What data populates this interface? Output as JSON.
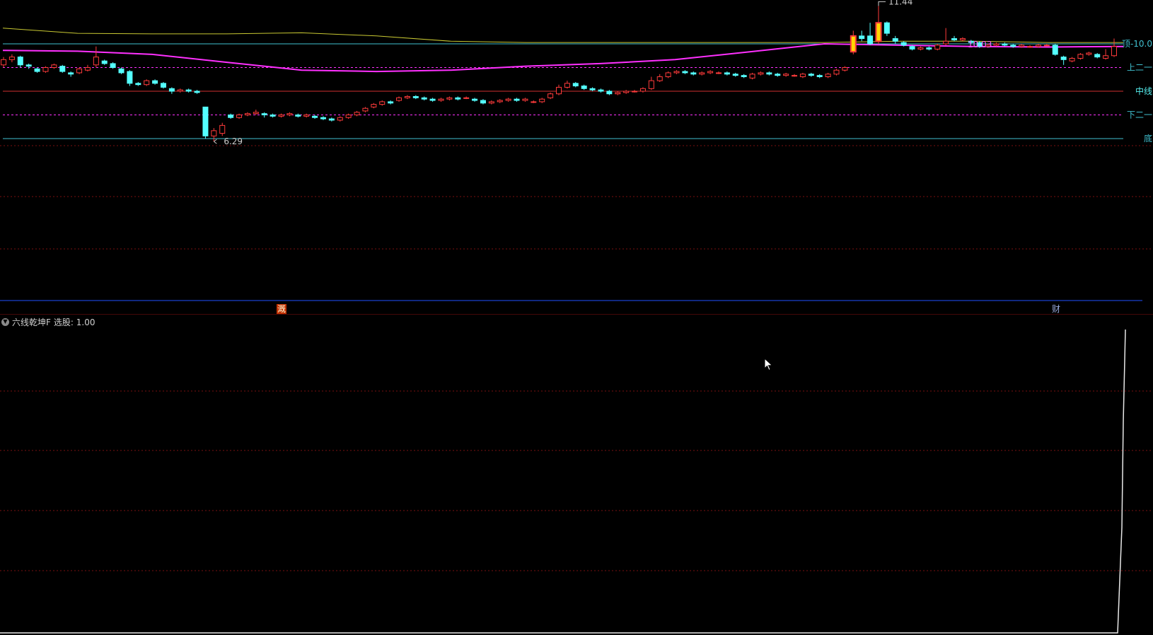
{
  "subpanel": {
    "title": "六线乾坤F",
    "value_label": "选股: 1.00"
  },
  "signals": {
    "a": "溉",
    "b": "财"
  },
  "icons": {
    "collapse": "chevron-down-icon",
    "cursor": "mouse-pointer-icon"
  },
  "colors": {
    "up": "#ff3b3b",
    "down": "#54ffff",
    "magenta": "#ff30ff",
    "yellow": "#c8c832",
    "cyan": "#40c0d0",
    "red_line": "#d03030",
    "grid": "#7a1010",
    "blue_sep": "#2050ff",
    "highlight": "#ffd800"
  },
  "chart_data": {
    "type": "candlestick",
    "ylim": [
      5.8,
      12.0
    ],
    "levels": [
      {
        "name": "顶",
        "value": 10.0,
        "display": "顶-10.0"
      },
      {
        "name": "上二一",
        "value": 9.1,
        "display": "上二一"
      },
      {
        "name": "中线",
        "value": 8.2,
        "display": "中线"
      },
      {
        "name": "下二一",
        "value": 7.3,
        "display": "下二一"
      },
      {
        "name": "底",
        "value": 6.4,
        "display": "底"
      }
    ],
    "annotations": {
      "high": "11.44",
      "low": "6.29",
      "mid": "10.03"
    },
    "magenta_line": [
      9.75,
      9.72,
      9.6,
      9.3,
      9.0,
      8.95,
      9.0,
      9.15,
      9.25,
      9.4,
      9.7,
      10.0,
      9.95,
      9.9,
      9.88,
      9.9
    ],
    "yellow_line": [
      10.6,
      10.4,
      10.38,
      10.38,
      10.42,
      10.3,
      10.1,
      10.05,
      10.05,
      10.05,
      10.05,
      10.05,
      10.1,
      10.1,
      10.05,
      10.05
    ],
    "candles": [
      [
        9.2,
        9.4,
        9.5,
        9.1
      ],
      [
        9.4,
        9.5,
        9.6,
        9.3
      ],
      [
        9.5,
        9.2,
        9.55,
        9.1
      ],
      [
        9.2,
        9.15,
        9.25,
        9.05
      ],
      [
        9.05,
        8.95,
        9.1,
        8.9
      ],
      [
        8.95,
        9.1,
        9.15,
        8.9
      ],
      [
        9.1,
        9.2,
        9.25,
        9.05
      ],
      [
        9.15,
        8.95,
        9.2,
        8.9
      ],
      [
        8.9,
        8.85,
        8.95,
        8.75
      ],
      [
        8.9,
        9.05,
        9.1,
        8.85
      ],
      [
        9.0,
        9.1,
        9.2,
        8.95
      ],
      [
        9.2,
        9.5,
        9.9,
        9.1
      ],
      [
        9.35,
        9.25,
        9.4,
        9.2
      ],
      [
        9.25,
        9.1,
        9.3,
        9.05
      ],
      [
        9.05,
        8.9,
        9.1,
        8.85
      ],
      [
        8.95,
        8.5,
        9.0,
        8.4
      ],
      [
        8.5,
        8.45,
        8.55,
        8.4
      ],
      [
        8.45,
        8.6,
        8.65,
        8.4
      ],
      [
        8.6,
        8.5,
        8.65,
        8.45
      ],
      [
        8.5,
        8.35,
        8.55,
        8.3
      ],
      [
        8.3,
        8.2,
        8.35,
        8.1
      ],
      [
        8.2,
        8.25,
        8.3,
        8.15
      ],
      [
        8.25,
        8.2,
        8.3,
        8.15
      ],
      [
        8.2,
        8.15,
        8.25,
        8.1
      ],
      [
        7.6,
        6.5,
        7.6,
        6.4
      ],
      [
        6.5,
        6.7,
        6.8,
        6.29
      ],
      [
        6.6,
        6.9,
        7.0,
        6.5
      ],
      [
        7.3,
        7.2,
        7.35,
        7.15
      ],
      [
        7.2,
        7.3,
        7.35,
        7.15
      ],
      [
        7.3,
        7.35,
        7.4,
        7.25
      ],
      [
        7.35,
        7.4,
        7.5,
        7.3
      ],
      [
        7.35,
        7.3,
        7.4,
        7.2
      ],
      [
        7.3,
        7.25,
        7.35,
        7.2
      ],
      [
        7.25,
        7.3,
        7.35,
        7.2
      ],
      [
        7.3,
        7.35,
        7.4,
        7.25
      ],
      [
        7.3,
        7.25,
        7.35,
        7.2
      ],
      [
        7.25,
        7.3,
        7.35,
        7.2
      ],
      [
        7.25,
        7.2,
        7.3,
        7.15
      ],
      [
        7.2,
        7.15,
        7.25,
        7.1
      ],
      [
        7.15,
        7.1,
        7.2,
        7.05
      ],
      [
        7.1,
        7.2,
        7.25,
        7.05
      ],
      [
        7.2,
        7.3,
        7.35,
        7.15
      ],
      [
        7.3,
        7.4,
        7.45,
        7.25
      ],
      [
        7.45,
        7.55,
        7.6,
        7.4
      ],
      [
        7.6,
        7.7,
        7.75,
        7.55
      ],
      [
        7.7,
        7.8,
        7.85,
        7.65
      ],
      [
        7.8,
        7.75,
        7.85,
        7.7
      ],
      [
        7.85,
        7.95,
        8.0,
        7.8
      ],
      [
        7.95,
        8.0,
        8.05,
        7.9
      ],
      [
        8.0,
        7.95,
        8.05,
        7.9
      ],
      [
        7.95,
        7.9,
        8.0,
        7.85
      ],
      [
        7.9,
        7.85,
        7.95,
        7.8
      ],
      [
        7.85,
        7.9,
        7.95,
        7.8
      ],
      [
        7.9,
        7.95,
        8.0,
        7.85
      ],
      [
        7.95,
        7.9,
        8.0,
        7.85
      ],
      [
        7.95,
        7.95,
        8.0,
        7.9
      ],
      [
        7.9,
        7.85,
        7.95,
        7.8
      ],
      [
        7.85,
        7.75,
        7.9,
        7.7
      ],
      [
        7.75,
        7.8,
        7.85,
        7.7
      ],
      [
        7.8,
        7.85,
        7.9,
        7.75
      ],
      [
        7.85,
        7.9,
        7.95,
        7.8
      ],
      [
        7.9,
        7.85,
        7.95,
        7.8
      ],
      [
        7.85,
        7.9,
        7.95,
        7.8
      ],
      [
        7.8,
        7.8,
        7.85,
        7.75
      ],
      [
        7.8,
        7.9,
        7.95,
        7.75
      ],
      [
        7.95,
        8.1,
        8.15,
        7.9
      ],
      [
        8.1,
        8.35,
        8.45,
        8.05
      ],
      [
        8.35,
        8.5,
        8.6,
        8.3
      ],
      [
        8.5,
        8.4,
        8.55,
        8.35
      ],
      [
        8.4,
        8.3,
        8.45,
        8.25
      ],
      [
        8.3,
        8.25,
        8.35,
        8.2
      ],
      [
        8.25,
        8.2,
        8.3,
        8.15
      ],
      [
        8.2,
        8.1,
        8.25,
        8.05
      ],
      [
        8.1,
        8.15,
        8.2,
        8.05
      ],
      [
        8.15,
        8.2,
        8.25,
        8.1
      ],
      [
        8.2,
        8.2,
        8.25,
        8.15
      ],
      [
        8.2,
        8.3,
        8.35,
        8.15
      ],
      [
        8.3,
        8.6,
        8.75,
        8.25
      ],
      [
        8.6,
        8.75,
        8.85,
        8.55
      ],
      [
        8.75,
        8.9,
        8.95,
        8.7
      ],
      [
        8.9,
        8.95,
        9.0,
        8.85
      ],
      [
        8.95,
        8.9,
        9.0,
        8.85
      ],
      [
        8.9,
        8.85,
        8.95,
        8.8
      ],
      [
        8.85,
        8.9,
        8.95,
        8.8
      ],
      [
        8.9,
        8.95,
        9.0,
        8.85
      ],
      [
        8.9,
        8.9,
        8.95,
        8.85
      ],
      [
        8.9,
        8.85,
        8.95,
        8.8
      ],
      [
        8.85,
        8.8,
        8.9,
        8.75
      ],
      [
        8.8,
        8.75,
        8.85,
        8.7
      ],
      [
        8.7,
        8.85,
        8.9,
        8.65
      ],
      [
        8.85,
        8.9,
        8.95,
        8.8
      ],
      [
        8.9,
        8.85,
        8.95,
        8.8
      ],
      [
        8.85,
        8.8,
        8.9,
        8.75
      ],
      [
        8.8,
        8.85,
        8.9,
        8.75
      ],
      [
        8.8,
        8.8,
        8.85,
        8.75
      ],
      [
        8.75,
        8.85,
        8.9,
        8.7
      ],
      [
        8.85,
        8.8,
        8.9,
        8.75
      ],
      [
        8.8,
        8.75,
        8.85,
        8.7
      ],
      [
        8.75,
        8.85,
        8.9,
        8.7
      ],
      [
        8.85,
        9.0,
        9.05,
        8.8
      ],
      [
        9.0,
        9.1,
        9.15,
        8.95
      ],
      [
        9.7,
        10.3,
        10.5,
        9.6
      ],
      [
        10.3,
        10.2,
        10.5,
        10.1
      ],
      [
        10.3,
        10.0,
        10.8,
        9.95
      ],
      [
        10.1,
        10.8,
        11.44,
        10.0
      ],
      [
        10.8,
        10.4,
        10.85,
        10.3
      ],
      [
        10.2,
        10.1,
        10.3,
        10.0
      ],
      [
        10.05,
        9.95,
        10.1,
        9.9
      ],
      [
        9.9,
        9.8,
        9.95,
        9.75
      ],
      [
        9.8,
        9.85,
        9.9,
        9.75
      ],
      [
        9.85,
        9.8,
        9.9,
        9.75
      ],
      [
        9.8,
        9.95,
        10.0,
        9.75
      ],
      [
        10.0,
        10.1,
        10.6,
        9.95
      ],
      [
        10.2,
        10.15,
        10.3,
        10.1
      ],
      [
        10.15,
        10.2,
        10.25,
        10.1
      ],
      [
        10.1,
        10.05,
        10.15,
        10.0
      ],
      [
        10.05,
        9.9,
        10.1,
        9.85
      ],
      [
        9.9,
        9.95,
        10.0,
        9.85
      ],
      [
        9.95,
        10.0,
        10.05,
        9.9
      ],
      [
        10.0,
        9.95,
        10.05,
        9.9
      ],
      [
        9.95,
        9.9,
        10.0,
        9.85
      ],
      [
        9.9,
        9.95,
        10.0,
        9.85
      ],
      [
        9.9,
        9.9,
        9.95,
        9.85
      ],
      [
        9.9,
        9.95,
        10.0,
        9.85
      ],
      [
        9.95,
        9.95,
        10.0,
        9.9
      ],
      [
        9.95,
        9.6,
        10.0,
        9.55
      ],
      [
        9.5,
        9.4,
        9.55,
        9.2
      ],
      [
        9.35,
        9.45,
        9.5,
        9.3
      ],
      [
        9.45,
        9.6,
        9.65,
        9.4
      ],
      [
        9.6,
        9.65,
        9.7,
        9.55
      ],
      [
        9.6,
        9.5,
        9.65,
        9.45
      ],
      [
        9.45,
        9.55,
        9.8,
        9.4
      ],
      [
        9.55,
        9.9,
        10.2,
        9.5
      ]
    ]
  }
}
